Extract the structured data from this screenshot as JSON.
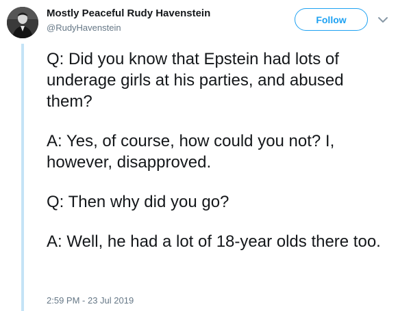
{
  "tweet": {
    "author": {
      "display_name": "Mostly Peaceful Rudy Havenstein",
      "screen_name": "@RudyHavenstein",
      "avatar_icon": "user-avatar"
    },
    "follow_label": "Follow",
    "more_icon": "chevron-down-icon",
    "paragraphs": [
      "Q: Did you know that Epstein had lots of underage girls at his parties, and abused them?",
      "A: Yes, of course, how could you not? I, however, disapproved.",
      "Q: Then why did you go?",
      "A: Well, he had a lot of 18-year olds there too."
    ],
    "timestamp": "2:59 PM - 23 Jul 2019"
  },
  "colors": {
    "accent": "#1da1f2",
    "text_primary": "#14171a",
    "text_secondary": "#657786",
    "thread_line": "#c4e3f6"
  }
}
